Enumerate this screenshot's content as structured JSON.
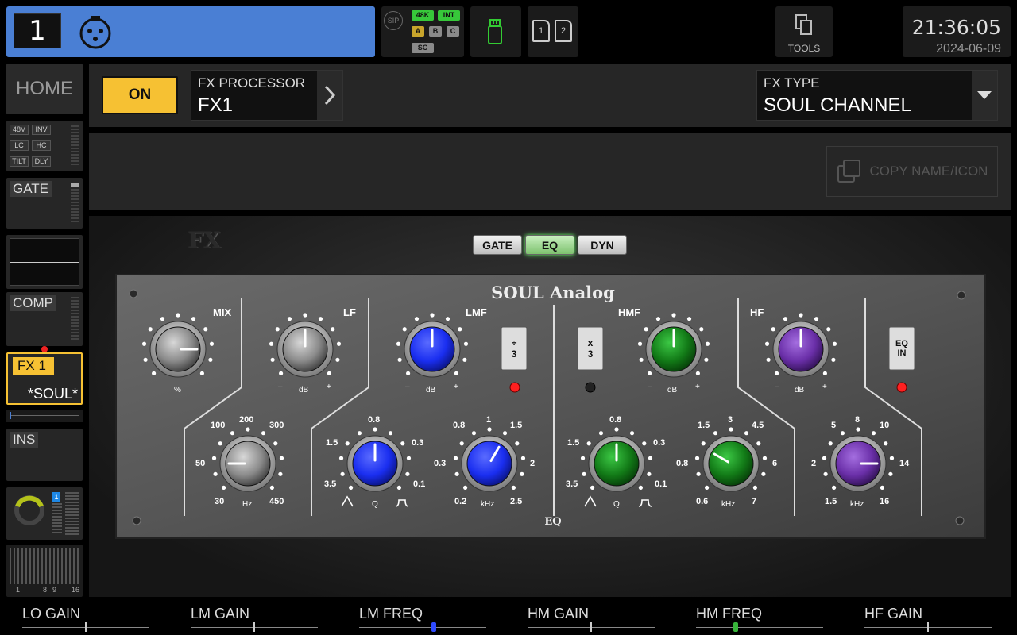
{
  "channel": {
    "number": "1",
    "icon": "xlr-icon"
  },
  "status": {
    "sip": "SIP",
    "rate": "48K",
    "clock": "INT",
    "a": "A",
    "b": "B",
    "c": "C",
    "sc": "SC",
    "colors": {
      "green": "#37c83a",
      "active_tag": "#c8a52c",
      "inactive_tag": "#8a8a8a"
    }
  },
  "cards": {
    "one": "1",
    "two": "2"
  },
  "tools": {
    "label": "TOOLS"
  },
  "clock": {
    "time": "21:36:05",
    "date": "2024-06-09"
  },
  "sidebar": {
    "home": "HOME",
    "input": {
      "b48v": "48V",
      "inv": "INV",
      "lc": "LC",
      "hc": "HC",
      "tilt": "TILT",
      "dly": "DLY"
    },
    "gate": "GATE",
    "comp": "COMP",
    "fx": {
      "label": "FX 1",
      "name": "*SOUL*"
    },
    "ins": "INS",
    "sends": {
      "badge": "1",
      "r1": "1",
      "r8": "8",
      "r9": "9",
      "r16": "16"
    }
  },
  "header": {
    "on_label": "ON",
    "fx_processor_label": "FX PROCESSOR",
    "fx_processor_value": "FX1",
    "fx_type_label": "FX TYPE",
    "fx_type_value": "SOUL CHANNEL",
    "copy_label": "COPY NAME/ICON"
  },
  "plugin": {
    "tabs": [
      "GATE",
      "EQ",
      "DYN"
    ],
    "active_tab": "EQ",
    "title": "SOUL Analog",
    "footer": "EQ",
    "logo": "FX",
    "mix": {
      "label": "MIX",
      "unit": "%"
    },
    "lf": {
      "label": "LF",
      "unit": "dB",
      "minus": "–",
      "plus": "+"
    },
    "lmf": {
      "label": "LMF",
      "unit": "dB",
      "minus": "–",
      "plus": "+",
      "div_sym": "÷",
      "div_num": "3"
    },
    "hmf": {
      "label": "HMF",
      "unit": "dB",
      "minus": "–",
      "plus": "+",
      "mul_sym": "x",
      "mul_num": "3"
    },
    "hf": {
      "label": "HF",
      "unit": "dB",
      "minus": "–",
      "plus": "+",
      "eq": "EQ",
      "in": "IN"
    },
    "lo_freq": {
      "t100": "100",
      "t200": "200",
      "t300": "300",
      "t50": "50",
      "t30": "30",
      "unit": "Hz",
      "t450": "450"
    },
    "lm_q": {
      "t08": "0.8",
      "t15": "1.5",
      "t03": "0.3",
      "t35": "3.5",
      "t01": "0.1",
      "unit": "Q"
    },
    "lm_freq": {
      "t08": "0.8",
      "t1": "1",
      "t15": "1.5",
      "t03": "0.3",
      "t2": "2",
      "t02": "0.2",
      "unit": "kHz",
      "t25": "2.5"
    },
    "hm_q": {
      "t08": "0.8",
      "t15": "1.5",
      "t03": "0.3",
      "t35": "3.5",
      "t01": "0.1",
      "unit": "Q"
    },
    "hm_freq": {
      "t15": "1.5",
      "t3": "3",
      "t45": "4.5",
      "t08": "0.8",
      "t6": "6",
      "t06": "0.6",
      "unit": "kHz",
      "t7": "7"
    },
    "hf_freq": {
      "t5": "5",
      "t8": "8",
      "t10": "10",
      "t2": "2",
      "t14": "14",
      "t15": "1.5",
      "unit": "kHz",
      "t16": "16"
    },
    "knob_colors": {
      "grey": "#8a8a8a",
      "blue": "#1a2ef0",
      "green": "#127a17",
      "purple": "#6a2fa8"
    }
  },
  "bottom": {
    "items": [
      {
        "label": "LO GAIN",
        "value": 0.5
      },
      {
        "label": "LM GAIN",
        "value": 0.5
      },
      {
        "label": "LM FREQ",
        "value": 0.59
      },
      {
        "label": "HM GAIN",
        "value": 0.5
      },
      {
        "label": "HM FREQ",
        "value": 0.31
      },
      {
        "label": "HF GAIN",
        "value": 0.5
      }
    ],
    "highlight": {
      "lm_freq": "#2f4bff",
      "hm_freq": "#37b43a"
    }
  }
}
